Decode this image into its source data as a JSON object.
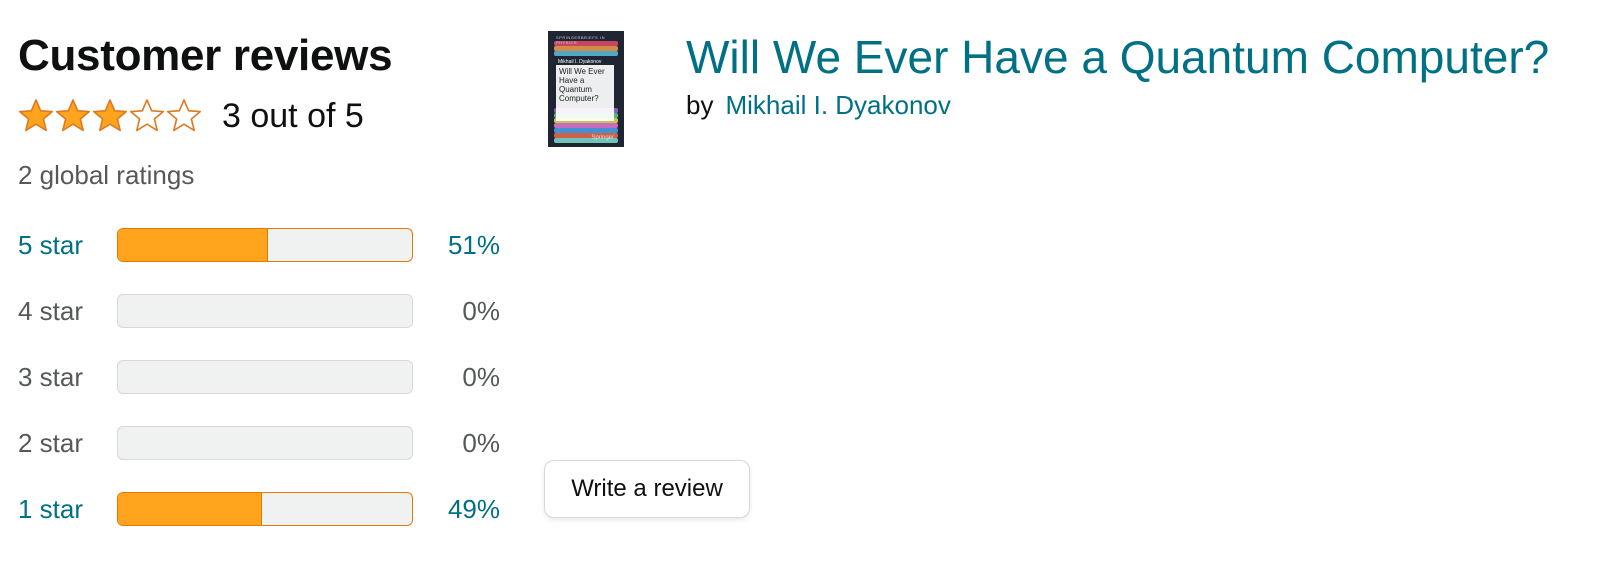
{
  "reviews": {
    "heading": "Customer reviews",
    "rating_text": "3 out of 5",
    "star_rating": 3,
    "star_max": 5,
    "global_ratings": "2 global ratings",
    "histogram": [
      {
        "label": "5 star",
        "percent_text": "51%",
        "percent": 51
      },
      {
        "label": "4 star",
        "percent_text": "0%",
        "percent": 0
      },
      {
        "label": "3 star",
        "percent_text": "0%",
        "percent": 0
      },
      {
        "label": "2 star",
        "percent_text": "0%",
        "percent": 0
      },
      {
        "label": "1 star",
        "percent_text": "49%",
        "percent": 49
      }
    ],
    "write_review_label": "Write a review"
  },
  "product": {
    "title": "Will We Ever Have a Quantum Computer?",
    "by_label": "by",
    "author": "Mikhail I. Dyakonov",
    "cover": {
      "series": "SPRINGERBRIEFS IN PHYSICS",
      "author": "Mikhail I. Dyakonov",
      "title": "Will We Ever Have a Quantum Computer?",
      "publisher": "Springer"
    }
  },
  "colors": {
    "link": "#007185",
    "star": "#ffa41c",
    "star_outline": "#de7921",
    "bar_fill": "#ffa41c"
  }
}
